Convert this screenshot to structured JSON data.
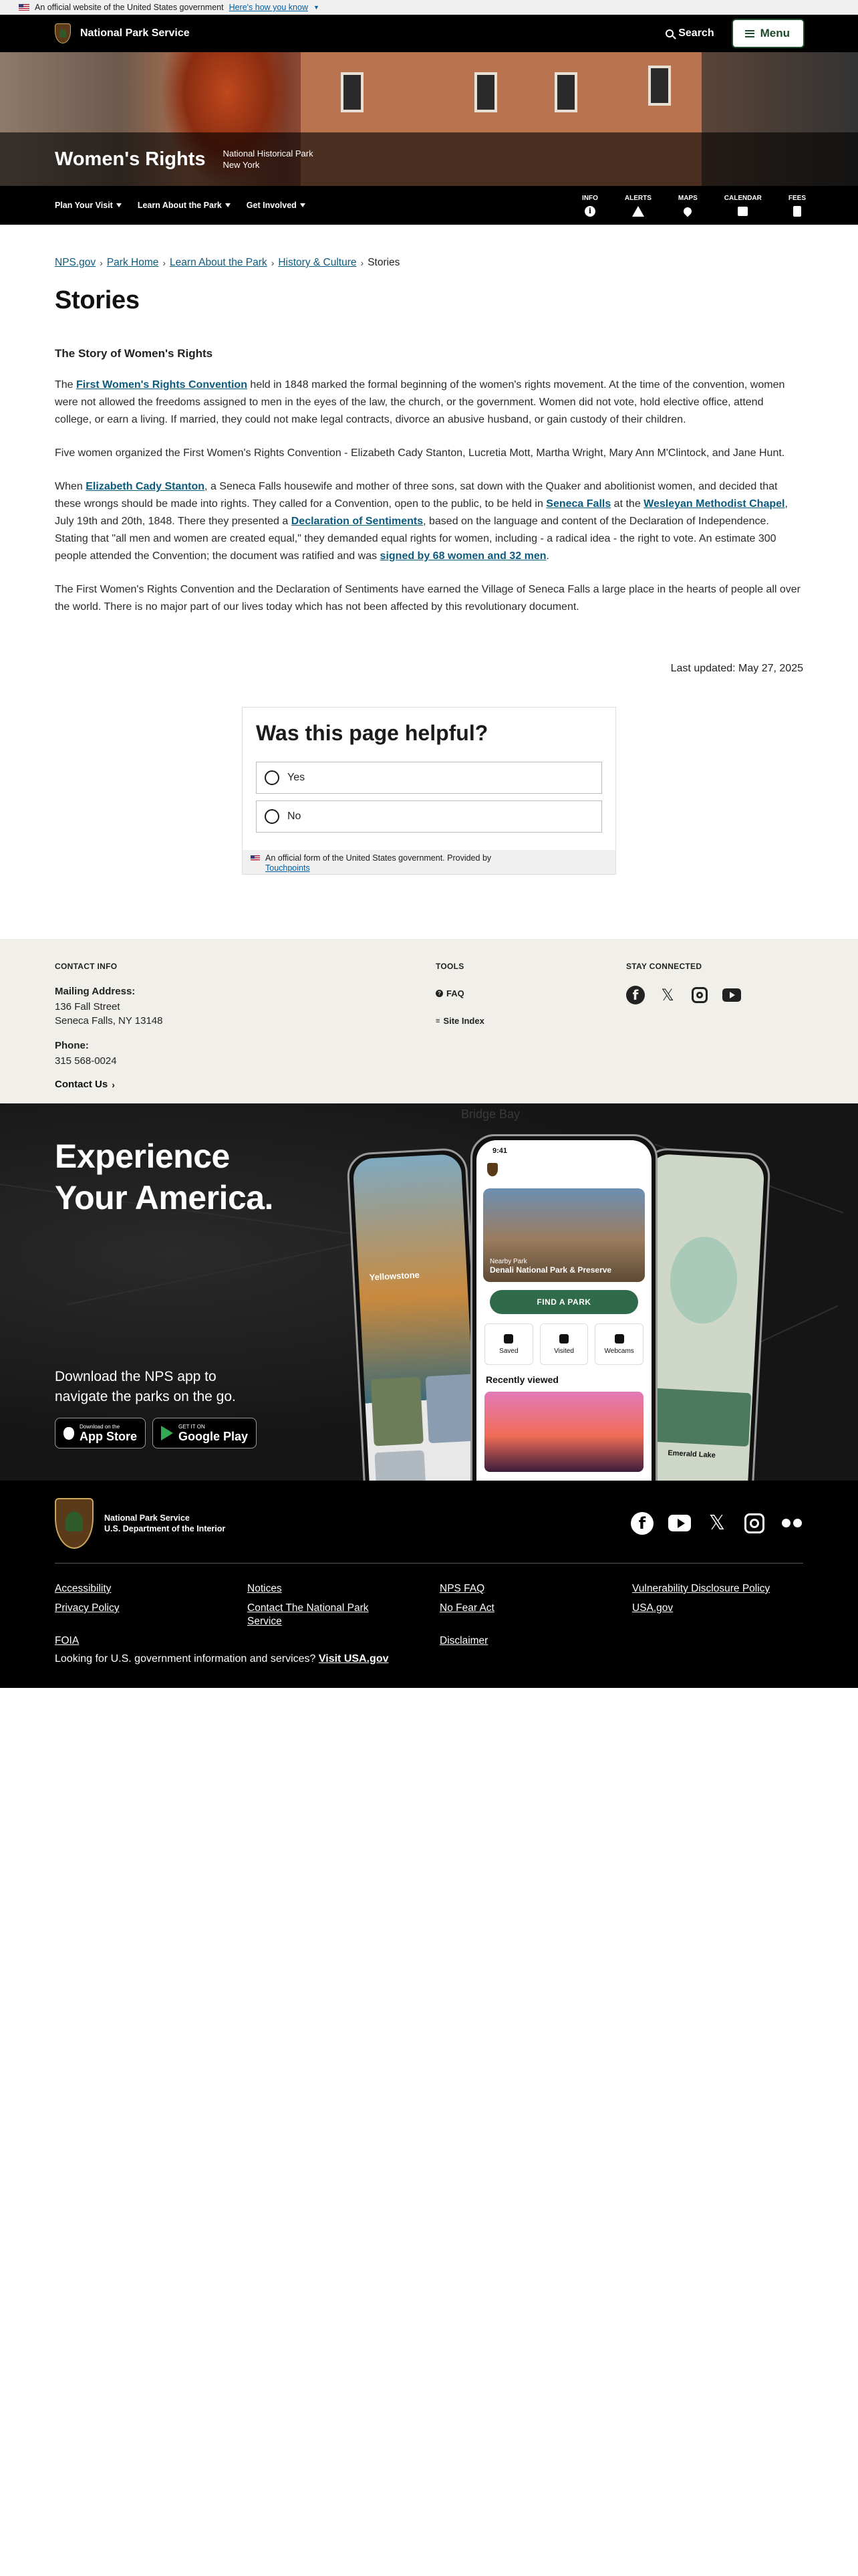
{
  "gov_banner": {
    "text": "An official website of the United States government",
    "know_link": "Here's how you know"
  },
  "header": {
    "brand": "National Park Service",
    "search_label": "Search",
    "menu_label": "Menu"
  },
  "hero": {
    "park_name": "Women's Rights",
    "designation": "National Historical Park",
    "state": "New York"
  },
  "park_nav": {
    "items": [
      {
        "label": "Plan Your Visit"
      },
      {
        "label": "Learn About the Park"
      },
      {
        "label": "Get Involved"
      }
    ],
    "quick_links": [
      {
        "label": "INFO",
        "icon": "info-icon"
      },
      {
        "label": "ALERTS",
        "icon": "alert-icon"
      },
      {
        "label": "MAPS",
        "icon": "map-pin-icon"
      },
      {
        "label": "CALENDAR",
        "icon": "calendar-icon"
      },
      {
        "label": "FEES",
        "icon": "fee-icon"
      }
    ]
  },
  "breadcrumb": [
    "NPS.gov",
    "Park Home",
    "Learn About the Park",
    "History & Culture",
    "Stories"
  ],
  "page_title": "Stories",
  "section_heading": "The Story of Women's Rights",
  "para1": {
    "pre": "The ",
    "link": "First Women's Rights Convention",
    "post": " held in 1848 marked the formal beginning of the women's rights movement. At the time of the convention, women were not allowed the freedoms assigned to men in the eyes of the law, the church, or the government. Women did not vote, hold elective office, attend college, or earn a living. If married, they could not make legal contracts, divorce an abusive husband, or gain custody of their children."
  },
  "para2": "Five women organized the First Women's Rights Convention - Elizabeth Cady Stanton, Lucretia Mott, Martha Wright, Mary Ann M'Clintock, and Jane Hunt.",
  "para3": {
    "t1": "When ",
    "l1": "Elizabeth Cady Stanton",
    "t2": ", a Seneca Falls housewife and mother of three sons, sat down with the Quaker and abolitionist women, and decided that these wrongs should be made into rights. They called for a Convention, open to the public, to be held in ",
    "l2": "Seneca Falls",
    "t3": " at the ",
    "l3": "Wesleyan Methodist Chapel",
    "t4": ", July 19th and 20th, 1848. There they presented a ",
    "l4": "Declaration of Sentiments",
    "t5": ", based on the language and content of the Declaration of Independence. Stating that \"all men and women are created equal,\" they demanded equal rights for women, including - a radical idea - the right to vote. An estimate 300 people attended the Convention; the document was ratified and was ",
    "l5": "signed by 68 women and 32 men",
    "t6": "."
  },
  "para4": "The First Women's Rights Convention and the Declaration of Sentiments have earned the Village of Seneca Falls a large place in the hearts of people all over the world. There is no major part of our lives today which has not been affected by this revolutionary document.",
  "last_updated": "Last updated: May 27, 2025",
  "feedback": {
    "question": "Was this page helpful?",
    "options": [
      "Yes",
      "No"
    ],
    "footer_text": "An official form of the United States government. Provided by",
    "footer_link": "Touchpoints"
  },
  "contact": {
    "heading": "CONTACT INFO",
    "mailing_label": "Mailing Address:",
    "address_line1": "136 Fall Street",
    "address_line2": "Seneca Falls, NY 13148",
    "phone_label": "Phone:",
    "phone": "315 568-0024",
    "contact_link": "Contact Us"
  },
  "tools": {
    "heading": "TOOLS",
    "items": [
      "FAQ",
      "Site Index"
    ]
  },
  "stay_connected": {
    "heading": "STAY CONNECTED",
    "icons": [
      "facebook-icon",
      "x-icon",
      "instagram-icon",
      "youtube-icon"
    ]
  },
  "app_promo": {
    "title_line1": "Experience",
    "title_line2": "Your America.",
    "text_line1": "Download the NPS app to",
    "text_line2": "navigate the parks on the go.",
    "app_store_small": "Download on the",
    "app_store_big": "App Store",
    "google_small": "GET IT ON",
    "google_big": "Google Play",
    "map_labels": [
      "Bridge Bay"
    ],
    "phone": {
      "time": "9:41",
      "nearby": "Nearby Park",
      "park": "Denali National Park & Preserve",
      "find": "FIND A PARK",
      "tiles": [
        "Saved",
        "Visited",
        "Webcams"
      ],
      "recent": "Recently viewed",
      "left_park": "Yellowstone",
      "right_place": "Emerald Lake"
    }
  },
  "footer": {
    "agency1": "National Park Service",
    "agency2": "U.S. Department of the Interior",
    "links": [
      "Accessibility",
      "Notices",
      "NPS FAQ",
      "Vulnerability Disclosure Policy",
      "Privacy Policy",
      "Contact The National Park Service",
      "No Fear Act",
      "USA.gov",
      "FOIA",
      "",
      "Disclaimer",
      ""
    ],
    "bottom_text": "Looking for U.S. government information and services? ",
    "bottom_link": "Visit USA.gov"
  },
  "colors": {
    "nps_green": "#1e4a2b",
    "link": "#0d5a7f",
    "footer_bg": "#000000",
    "contact_bg": "#f1efe9"
  }
}
